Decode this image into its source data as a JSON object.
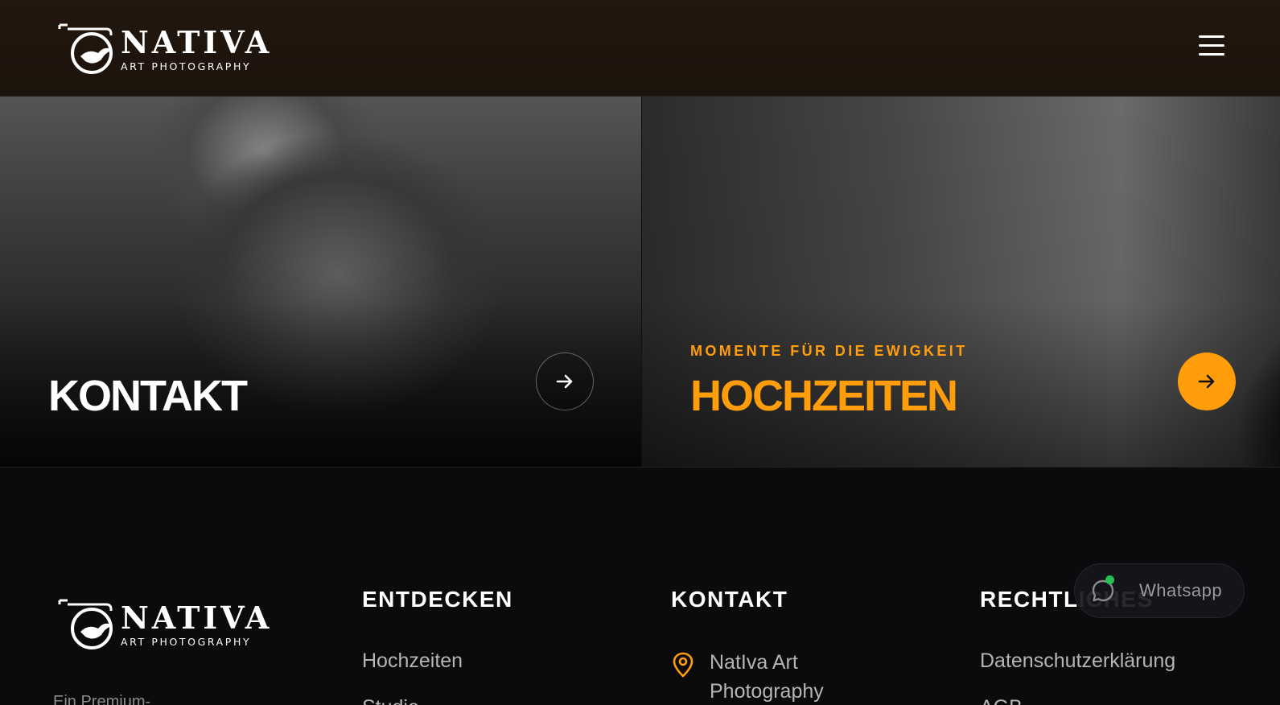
{
  "header": {
    "brand": "NATIVA",
    "brand_sub": "ART PHOTOGRAPHY",
    "menu_icon": "hamburger-menu-icon"
  },
  "panels": [
    {
      "title": "KONTAKT",
      "kicker": "",
      "title_color": "#ffffff",
      "arrow_style": "outline"
    },
    {
      "title": "HOCHZEITEN",
      "kicker": "MOMENTE FÜR DIE EWIGKEIT",
      "title_color": "#ff9d0a",
      "arrow_style": "filled"
    }
  ],
  "footer": {
    "brand": "NATIVA",
    "brand_sub": "ART PHOTOGRAPHY",
    "tagline": "Ein Premium-",
    "columns": {
      "entdecken": {
        "heading": "ENTDECKEN",
        "links": [
          "Hochzeiten",
          "Studio"
        ]
      },
      "kontakt": {
        "heading": "KONTAKT",
        "address_line1": "NatIva Art",
        "address_line2": "Photography"
      },
      "rechtliches": {
        "heading": "RECHTLICHES",
        "links": [
          "Datenschutzerklärung",
          "AGB"
        ]
      }
    }
  },
  "whatsapp": {
    "label": "Whatsapp",
    "status_color": "#25c155"
  },
  "colors": {
    "accent": "#ff9d0a",
    "header_bg": "#1f150d",
    "footer_bg": "#0b0a0d"
  }
}
